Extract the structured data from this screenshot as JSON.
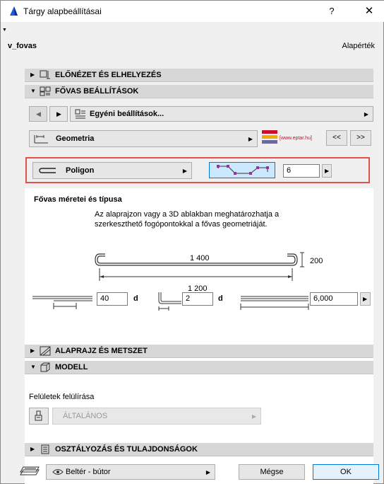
{
  "window": {
    "title": "Tárgy alapbeállításai",
    "help": "?",
    "close": "✕"
  },
  "header": {
    "name": "v_fovas",
    "default_label": "Alapérték"
  },
  "sections": {
    "preview": "ELŐNÉZET ÉS ELHELYEZÉS",
    "settings": "FŐVAS BEÁLLÍTÁSOK",
    "floorplan": "ALAPRAJZ ÉS METSZET",
    "model": "MODELL",
    "classification": "OSZTÁLYOZÁS ÉS TULAJDONSÁGOK"
  },
  "custom_settings": {
    "label": "Egyéni beállítások..."
  },
  "geometry": {
    "label": "Geometria",
    "logo_text": "[www.eptar.hu]",
    "prev": "<<",
    "next": ">>"
  },
  "polygon": {
    "label": "Poligon",
    "count": "6"
  },
  "dimensions": {
    "title": "Fővas méretei és típusa",
    "desc_line1": "Az alaprajzon vagy a 3D ablakban meghatározhatja a",
    "desc_line2": "szerkeszthető fogópontokkal a fővas geometriáját.",
    "top_length": "1 400",
    "height": "200",
    "bottom_length": "1 200"
  },
  "params": {
    "anchor_value": "40",
    "anchor_unit": "d",
    "hook_value": "2",
    "hook_unit": "d",
    "length_value": "6,000"
  },
  "model": {
    "override_label": "Felületek felülírása",
    "surface_value": "ÁLTALÁNOS"
  },
  "footer": {
    "layer_value": "Beltér - bútor",
    "cancel": "Mégse",
    "ok": "OK"
  },
  "colors": {
    "highlight": "#e0524a",
    "polygon_fill": "#cce8ff",
    "polygon_border": "#0078d7",
    "node": "#9b2f9b"
  }
}
